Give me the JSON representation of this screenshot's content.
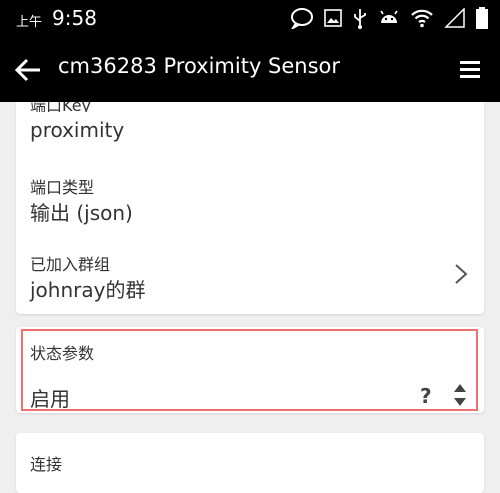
{
  "status_bar": {
    "ampm": "上午",
    "time": "9:58"
  },
  "app_bar": {
    "title": "cm36283 Proximity Sensor"
  },
  "port_info": {
    "key_label": "端口Key",
    "key_value": "proximity",
    "type_label": "端口类型",
    "type_value": "输出 (json)",
    "group_label": "已加入群组",
    "group_value": "johnray的群"
  },
  "status_params": {
    "label": "状态参数",
    "value": "启用",
    "help": "?"
  },
  "connect": {
    "label": "连接"
  },
  "colors": {
    "highlight": "#f07070",
    "bar": "#000000"
  }
}
